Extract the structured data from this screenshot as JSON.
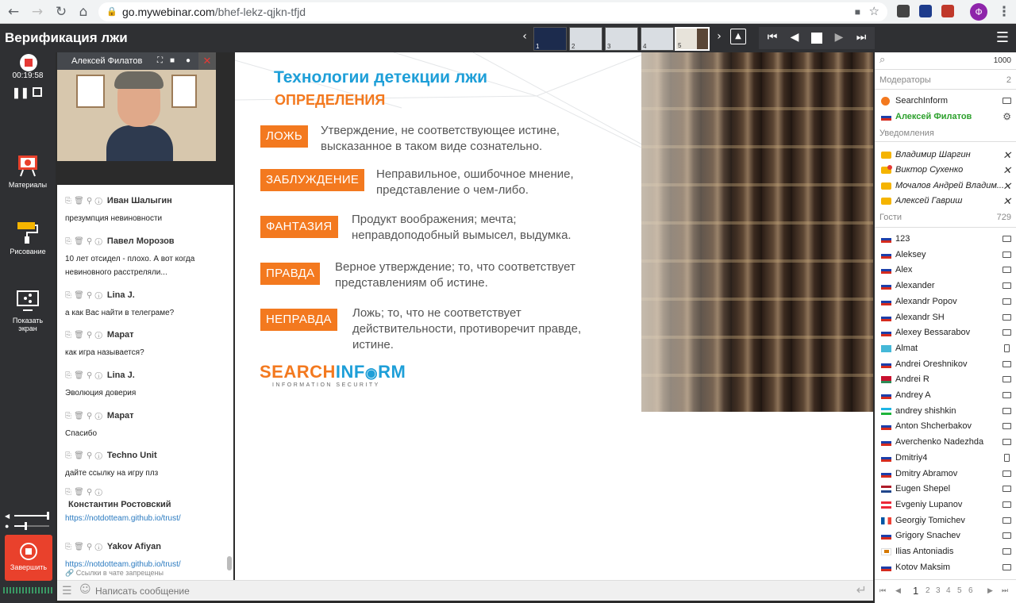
{
  "browser": {
    "url_host": "go.mywebinar.com",
    "url_path": "/bhef-lekz-qjkn-tfjd",
    "avatar_letter": "Ф"
  },
  "header": {
    "title": "Верификация лжи",
    "thumbs": [
      "1",
      "2",
      "3",
      "4",
      "5"
    ]
  },
  "rail": {
    "timer": "00:19:58",
    "materials": "Материалы",
    "drawing": "Рисование",
    "share_line1": "Показать",
    "share_line2": "экран",
    "end": "Завершить"
  },
  "video": {
    "speaker": "Алексей Филатов"
  },
  "chat": {
    "messages": [
      {
        "author": "Иван Шалыгин",
        "text": "презумпция невиновности"
      },
      {
        "author": "Павел Морозов",
        "text": "10 лет отсидел - плохо. А вот когда невиновного расстреляли..."
      },
      {
        "author": "Lina J.",
        "text": "а как Вас найти в телеграме?"
      },
      {
        "author": "Марат",
        "text": "как игра называется?"
      },
      {
        "author": "Lina J.",
        "text": "Эволюция доверия"
      },
      {
        "author": "Марат",
        "text": "Спасибо"
      },
      {
        "author": "Techno Unit",
        "text": "дайте ссылку на игру плз"
      },
      {
        "author": "Константин Ростовский",
        "text": "https://notdotteam.github.io/trust/"
      },
      {
        "author": "Yakov Afiyan",
        "text": "https://notdotteam.github.io/trust/"
      }
    ],
    "links_forbidden": "Ссылки в чате запрещены",
    "input_placeholder": "Написать сообщение"
  },
  "slide": {
    "title": "Технологии детекции лжи",
    "subtitle": "ОПРЕДЕЛЕНИЯ",
    "items": [
      {
        "term": "ЛОЖЬ",
        "line1": "Утверждение, не соответствующее истине,",
        "line2": "высказанное в таком виде сознательно.",
        "line3": ""
      },
      {
        "term": "ЗАБЛУЖДЕНИЕ",
        "line1": "Неправильное, ошибочное мнение,",
        "line2": "представление о чем-либо.",
        "line3": ""
      },
      {
        "term": "ФАНТАЗИЯ",
        "line1": "Продукт воображения; мечта;",
        "line2": "неправдоподобный вымысел, выдумка.",
        "line3": ""
      },
      {
        "term": "ПРАВДА",
        "line1": "Верное утверждение; то, что соответствует",
        "line2": "представлениям об истине.",
        "line3": ""
      },
      {
        "term": "НЕПРАВДА",
        "line1": "Ложь; то, что не соответствует",
        "line2": "действительности, противоречит правде,",
        "line3": "истине."
      }
    ],
    "logo_a": "SEARCH",
    "logo_b": "INF",
    "logo_c": "RM",
    "logo_sub": "INFORMATION SECURITY",
    "colors": {
      "accent": "#f3791f",
      "title": "#1e9fd8"
    }
  },
  "participants": {
    "total": "1000",
    "moderators_label": "Модераторы",
    "moderators_count": "2",
    "moderators": [
      "SearchInform",
      "Алексей Филатов"
    ],
    "notifications_label": "Уведомления",
    "notifications": [
      "Владимир Шаргин",
      "Виктор Сухенко",
      "Мочалов Андрей Владим...",
      "Алексей Гавриш"
    ],
    "guests_label": "Гости",
    "guests_count": "729",
    "guests": [
      "123",
      "Aleksey",
      "Alex",
      "Alexander",
      "Alexandr Popov",
      "Alexandr SH",
      "Alexey Bessarabov",
      "Almat",
      "Andrei Oreshnikov",
      "Andrei R",
      "Andrey A",
      "andrey shishkin",
      "Anton Shcherbakov",
      "Averchenko Nadezhda",
      "Dmitriy4",
      "Dmitry Abramov",
      "Eugen Shepel",
      "Evgeniy Lupanov",
      "Georgiy Tomichev",
      "Grigory Snachev",
      "Ilias Antoniadis",
      "Kotov Maksim"
    ],
    "pages": [
      "1",
      "2",
      "3",
      "4",
      "5",
      "6"
    ]
  }
}
